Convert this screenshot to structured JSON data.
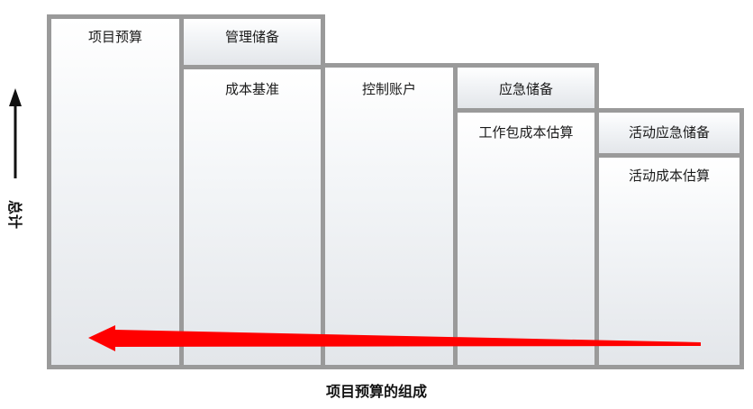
{
  "y_axis_label": "总计",
  "x_axis_label": "项目预算的组成",
  "columns": [
    {
      "id": "project-budget",
      "top_label": "项目预算"
    },
    {
      "id": "cost-baseline",
      "top_label": "管理储备",
      "lower_label": "成本基准"
    },
    {
      "id": "control-account",
      "top_label": "控制账户"
    },
    {
      "id": "work-package",
      "top_label": "应急储备",
      "lower_label": "工作包成本估算"
    },
    {
      "id": "activity",
      "top_label": "活动应急储备",
      "lower_label": "活动成本估算"
    }
  ],
  "colors": {
    "border": "#9a9a9a",
    "arrow": "#ff0000",
    "axis": "#111111"
  }
}
